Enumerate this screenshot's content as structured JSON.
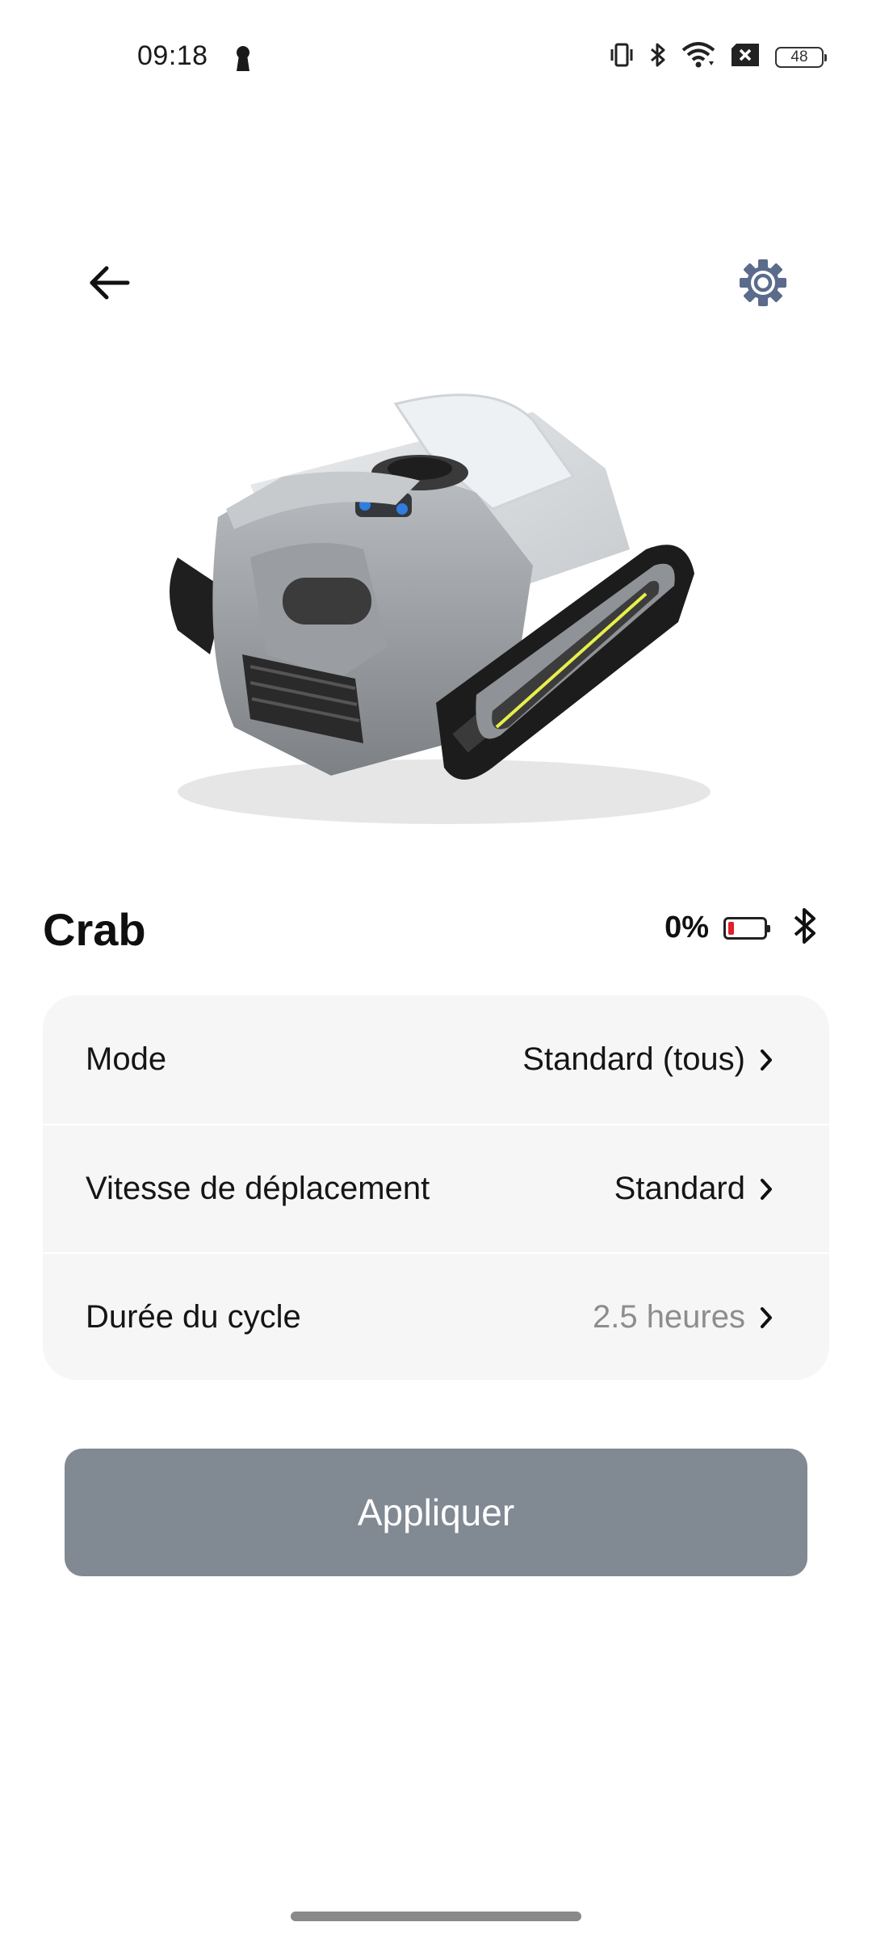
{
  "status_bar": {
    "time": "09:18",
    "battery_level": "48",
    "icons": [
      "keyhole-icon",
      "vibrate-icon",
      "bluetooth-icon",
      "wifi-icon",
      "no-sim-icon",
      "battery-icon"
    ]
  },
  "nav": {
    "back_icon": "arrow-left-icon",
    "settings_icon": "gear-icon"
  },
  "device": {
    "name": "Crab",
    "battery_percent": "0%",
    "battery_color": "#e0202a",
    "connection_icon": "bluetooth-icon"
  },
  "settings": [
    {
      "label": "Mode",
      "value": "Standard (tous)",
      "muted": false
    },
    {
      "label": "Vitesse de déplacement",
      "value": "Standard",
      "muted": false
    },
    {
      "label": "Durée du cycle",
      "value": "2.5 heures",
      "muted": true
    }
  ],
  "apply_label": "Appliquer",
  "colors": {
    "accent_button": "#818993",
    "gear_icon": "#5a6b8c",
    "card_background": "#f6f6f6",
    "robot_accent": "#e8f04a"
  }
}
